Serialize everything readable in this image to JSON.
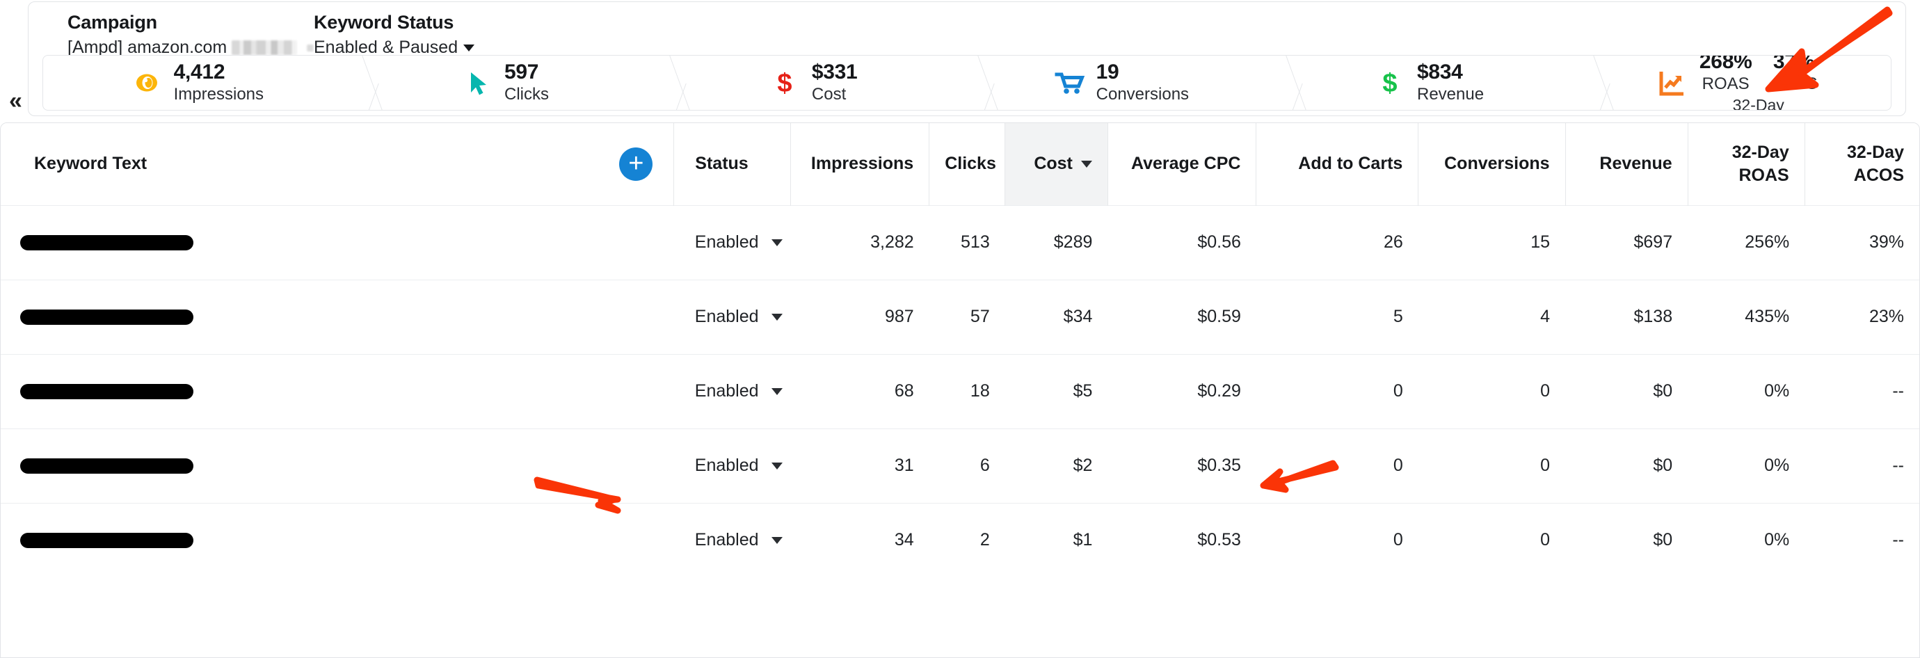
{
  "sidebar": {
    "collapse_icon": "chevron-double-left-icon"
  },
  "summary": {
    "campaign": {
      "title": "Campaign",
      "value": "[Ampd] amazon.com",
      "redacted": true
    },
    "keyword_status": {
      "title": "Keyword Status",
      "value": "Enabled & Paused",
      "dropdown_icon": "chevron-down-icon"
    },
    "metrics": [
      {
        "icon": "eye-icon",
        "icon_color": "#fcb50a",
        "value": "4,412",
        "label": "Impressions"
      },
      {
        "icon": "cursor-click-icon",
        "icon_color": "#06b6ae",
        "value": "597",
        "label": "Clicks"
      },
      {
        "icon": "dollar-sign-icon",
        "icon_color": "#e62117",
        "value": "$331",
        "label": "Cost"
      },
      {
        "icon": "shopping-cart-icon",
        "icon_color": "#1583d4",
        "value": "19",
        "label": "Conversions"
      },
      {
        "icon": "dollar-sign-icon",
        "icon_color": "#17c24a",
        "value": "$834",
        "label": "Revenue"
      }
    ],
    "roas_acos": {
      "icon": "trending-up-chart-icon",
      "icon_color": "#f57a1f",
      "roas_value": "268%",
      "roas_label": "ROAS",
      "acos_value": "37%",
      "acos_label": "ACOS",
      "period": "32-Day"
    }
  },
  "table": {
    "add_button_icon": "plus-icon",
    "sorted_column": "Cost",
    "sort_direction_icon": "caret-down-icon",
    "columns": [
      {
        "key": "keyword",
        "label": "Keyword Text",
        "align": "left"
      },
      {
        "key": "status",
        "label": "Status",
        "align": "left"
      },
      {
        "key": "impressions",
        "label": "Impressions",
        "align": "right"
      },
      {
        "key": "clicks",
        "label": "Clicks",
        "align": "right"
      },
      {
        "key": "cost",
        "label": "Cost",
        "align": "right"
      },
      {
        "key": "avg_cpc",
        "label": "Average CPC",
        "align": "right"
      },
      {
        "key": "add_to_carts",
        "label": "Add to Carts",
        "align": "right"
      },
      {
        "key": "conversions",
        "label": "Conversions",
        "align": "right"
      },
      {
        "key": "revenue",
        "label": "Revenue",
        "align": "right"
      },
      {
        "key": "roas",
        "label": "32-Day\nROAS",
        "line1": "32-Day",
        "line2": "ROAS",
        "align": "right"
      },
      {
        "key": "acos",
        "label": "32-Day\nACOS",
        "line1": "32-Day",
        "line2": "ACOS",
        "align": "right"
      }
    ],
    "rows": [
      {
        "keyword": "",
        "keyword_redacted": true,
        "status": "Enabled",
        "impressions": "3,282",
        "clicks": "513",
        "cost": "$289",
        "avg_cpc": "$0.56",
        "add_to_carts": "26",
        "conversions": "15",
        "revenue": "$697",
        "roas": "256%",
        "acos": "39%"
      },
      {
        "keyword": "",
        "keyword_redacted": true,
        "status": "Enabled",
        "impressions": "987",
        "clicks": "57",
        "cost": "$34",
        "avg_cpc": "$0.59",
        "add_to_carts": "5",
        "conversions": "4",
        "revenue": "$138",
        "roas": "435%",
        "acos": "23%"
      },
      {
        "keyword": "",
        "keyword_redacted": true,
        "status": "Enabled",
        "impressions": "68",
        "clicks": "18",
        "cost": "$5",
        "avg_cpc": "$0.29",
        "add_to_carts": "0",
        "conversions": "0",
        "revenue": "$0",
        "roas": "0%",
        "acos": "--"
      },
      {
        "keyword": "",
        "keyword_redacted": true,
        "status": "Enabled",
        "impressions": "31",
        "clicks": "6",
        "cost": "$2",
        "avg_cpc": "$0.35",
        "add_to_carts": "0",
        "conversions": "0",
        "revenue": "$0",
        "roas": "0%",
        "acos": "--"
      },
      {
        "keyword": "",
        "keyword_redacted": true,
        "status": "Enabled",
        "impressions": "34",
        "clicks": "2",
        "cost": "$1",
        "avg_cpc": "$0.53",
        "add_to_carts": "0",
        "conversions": "0",
        "revenue": "$0",
        "roas": "0%",
        "acos": "--"
      }
    ],
    "status_dropdown_icon": "caret-down-icon"
  },
  "annotations": {
    "color": "#fa3407",
    "arrows": [
      {
        "name": "arrow-pointing-to-acos",
        "direction": "down-left"
      },
      {
        "name": "arrow-pointing-to-status-cell",
        "direction": "right"
      },
      {
        "name": "arrow-pointing-to-average-cpc",
        "direction": "up-left"
      }
    ]
  }
}
